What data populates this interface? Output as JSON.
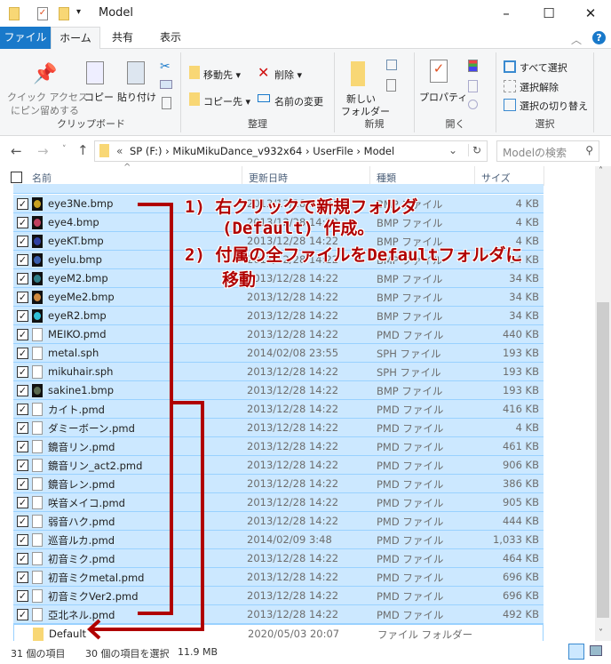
{
  "window": {
    "title": "Model",
    "minimize": "–",
    "maximize": "☐",
    "close": "✕"
  },
  "tabs": [
    {
      "label": "ファイル",
      "active": false
    },
    {
      "label": "ホーム",
      "active": true
    },
    {
      "label": "共有"
    },
    {
      "label": "表示"
    }
  ],
  "ribbon": {
    "clipboard": {
      "pin": "クイック アクセス",
      "pin2": "にピン留めする",
      "copy": "コピー",
      "paste": "貼り付け",
      "label": "クリップボード"
    },
    "organize": {
      "move_to": "移動先",
      "copy_to": "コピー先",
      "delete": "削除",
      "rename": "名前の変更",
      "label": "整理"
    },
    "new": {
      "new_folder": "新しい",
      "new_folder2": "フォルダー",
      "label": "新規"
    },
    "open": {
      "properties": "プロパティ",
      "label": "開く"
    },
    "select": {
      "all": "すべて選択",
      "none": "選択解除",
      "invert": "選択の切り替え",
      "label": "選択"
    }
  },
  "address": {
    "prefix": "«",
    "path": [
      "SP (F:)",
      "MikuMikuDance_v932x64",
      "UserFile",
      "Model"
    ],
    "search_placeholder": "Modelの検索"
  },
  "columns": {
    "name": "名前",
    "date": "更新日時",
    "type": "種類",
    "size": "サイズ"
  },
  "files": [
    {
      "name": "eye3Ne.bmp",
      "date": "2013/12/28 14:22",
      "type": "BMP ファイル",
      "size": "4 KB",
      "icon": "#c8a020"
    },
    {
      "name": "eye4.bmp",
      "date": "2013/12/28 14:22",
      "type": "BMP ファイル",
      "size": "4 KB",
      "icon": "#c04060"
    },
    {
      "name": "eyeKT.bmp",
      "date": "2013/12/28 14:22",
      "type": "BMP ファイル",
      "size": "4 KB",
      "icon": "#3040a0"
    },
    {
      "name": "eyelu.bmp",
      "date": "2013/12/28 14:22",
      "type": "BMP ファイル",
      "size": "34 KB",
      "icon": "#3a5fb0"
    },
    {
      "name": "eyeM2.bmp",
      "date": "2013/12/28 14:22",
      "type": "BMP ファイル",
      "size": "34 KB",
      "icon": "#2f7f88"
    },
    {
      "name": "eyeMe2.bmp",
      "date": "2013/12/28 14:22",
      "type": "BMP ファイル",
      "size": "34 KB",
      "icon": "#d08a40"
    },
    {
      "name": "eyeR2.bmp",
      "date": "2013/12/28 14:22",
      "type": "BMP ファイル",
      "size": "34 KB",
      "icon": "#30c0d8"
    },
    {
      "name": "MEIKO.pmd",
      "date": "2013/12/28 14:22",
      "type": "PMD ファイル",
      "size": "440 KB"
    },
    {
      "name": "metal.sph",
      "date": "2014/02/08 23:55",
      "type": "SPH ファイル",
      "size": "193 KB"
    },
    {
      "name": "mikuhair.sph",
      "date": "2013/12/28 14:22",
      "type": "SPH ファイル",
      "size": "193 KB"
    },
    {
      "name": "sakine1.bmp",
      "date": "2013/12/28 14:22",
      "type": "BMP ファイル",
      "size": "193 KB",
      "icon": "#5a6a50"
    },
    {
      "name": "カイト.pmd",
      "date": "2013/12/28 14:22",
      "type": "PMD ファイル",
      "size": "416 KB"
    },
    {
      "name": "ダミーボーン.pmd",
      "date": "2013/12/28 14:22",
      "type": "PMD ファイル",
      "size": "4 KB"
    },
    {
      "name": "鏡音リン.pmd",
      "date": "2013/12/28 14:22",
      "type": "PMD ファイル",
      "size": "461 KB"
    },
    {
      "name": "鏡音リン_act2.pmd",
      "date": "2013/12/28 14:22",
      "type": "PMD ファイル",
      "size": "906 KB"
    },
    {
      "name": "鏡音レン.pmd",
      "date": "2013/12/28 14:22",
      "type": "PMD ファイル",
      "size": "386 KB"
    },
    {
      "name": "咲音メイコ.pmd",
      "date": "2013/12/28 14:22",
      "type": "PMD ファイル",
      "size": "905 KB"
    },
    {
      "name": "弱音ハク.pmd",
      "date": "2013/12/28 14:22",
      "type": "PMD ファイル",
      "size": "444 KB"
    },
    {
      "name": "巡音ルカ.pmd",
      "date": "2014/02/09 3:48",
      "type": "PMD ファイル",
      "size": "1,033 KB"
    },
    {
      "name": "初音ミク.pmd",
      "date": "2013/12/28 14:22",
      "type": "PMD ファイル",
      "size": "464 KB"
    },
    {
      "name": "初音ミクmetal.pmd",
      "date": "2013/12/28 14:22",
      "type": "PMD ファイル",
      "size": "696 KB"
    },
    {
      "name": "初音ミクVer2.pmd",
      "date": "2013/12/28 14:22",
      "type": "PMD ファイル",
      "size": "696 KB"
    },
    {
      "name": "亞北ネル.pmd",
      "date": "2013/12/28 14:22",
      "type": "PMD ファイル",
      "size": "492 KB"
    }
  ],
  "folder": {
    "name": "Default",
    "date": "2020/05/03 20:07",
    "type": "ファイル フォルダー"
  },
  "annotation": {
    "line1": "1) 右クリックで新規フォルダ",
    "line2": "(Default) 作成。",
    "line3": "2) 付属の全ファイルをDefaultフォルダに",
    "line4": "移動",
    "color": "#b00000"
  },
  "status": {
    "count": "31 個の項目",
    "selected": "30 個の項目を選択",
    "size": "11.9 MB"
  }
}
